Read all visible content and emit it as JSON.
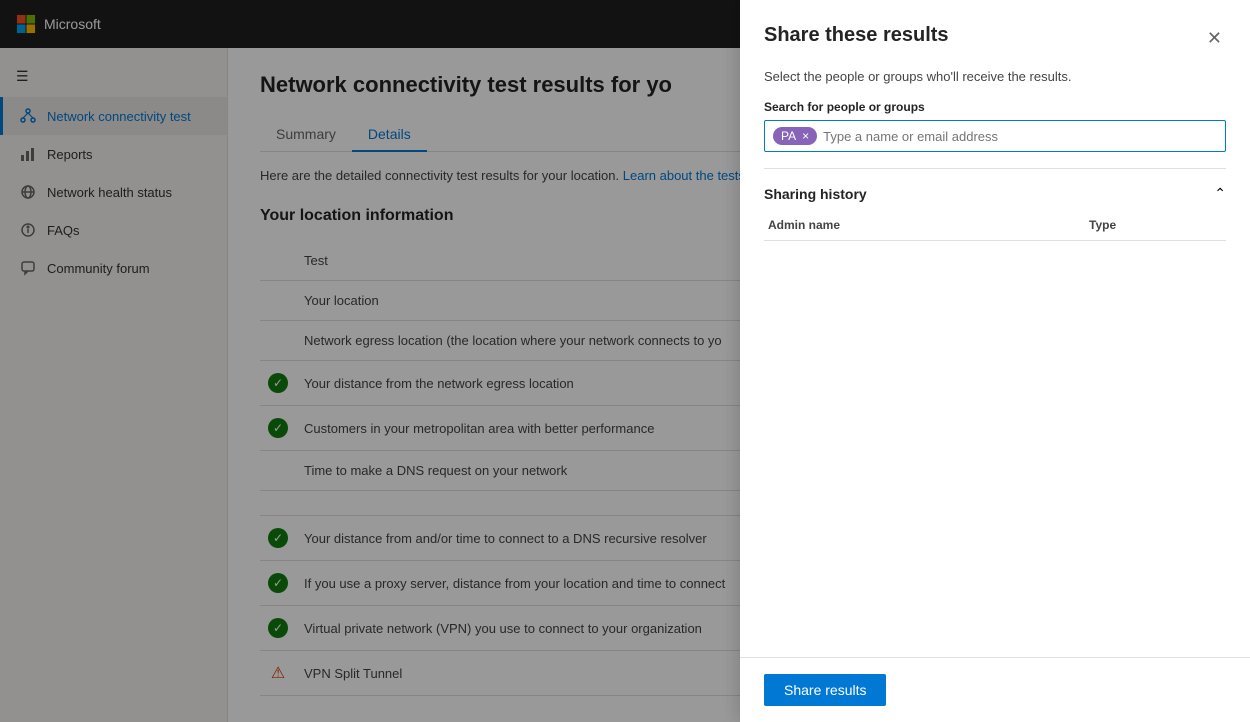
{
  "topbar": {
    "logo_text": "Microsoft"
  },
  "sidebar": {
    "hamburger_label": "☰",
    "items": [
      {
        "id": "network-connectivity",
        "label": "Network connectivity test",
        "icon": "network",
        "active": true
      },
      {
        "id": "reports",
        "label": "Reports",
        "icon": "bar-chart"
      },
      {
        "id": "network-health",
        "label": "Network health status",
        "icon": "globe"
      },
      {
        "id": "faqs",
        "label": "FAQs",
        "icon": "info"
      },
      {
        "id": "community-forum",
        "label": "Community forum",
        "icon": "chat"
      }
    ]
  },
  "main": {
    "page_title": "Network connectivity test results for yo",
    "tabs": [
      {
        "id": "summary",
        "label": "Summary",
        "active": false
      },
      {
        "id": "details",
        "label": "Details",
        "active": true
      }
    ],
    "description": "Here are the detailed connectivity test results for your location.",
    "learn_link": "Learn about the tests",
    "section_title": "Your location information",
    "rows": [
      {
        "status": "",
        "text": "Test"
      },
      {
        "status": "",
        "text": "Your location"
      },
      {
        "status": "",
        "text": ""
      },
      {
        "status": "",
        "text": "Network egress location (the location where your network connects to yo"
      },
      {
        "status": "ok",
        "text": "Your distance from the network egress location"
      },
      {
        "status": "ok",
        "text": "Customers in your metropolitan area with better performance"
      },
      {
        "status": "",
        "text": ""
      },
      {
        "status": "",
        "text": "Time to make a DNS request on your network"
      },
      {
        "status": "",
        "text": ""
      },
      {
        "status": "ok",
        "text": "Your distance from and/or time to connect to a DNS recursive resolver"
      },
      {
        "status": "ok",
        "text": "If you use a proxy server, distance from your location and time to connect"
      },
      {
        "status": "ok",
        "text": "Virtual private network (VPN) you use to connect to your organization"
      },
      {
        "status": "warn",
        "text": "VPN Split Tunnel"
      }
    ]
  },
  "panel": {
    "title": "Share these results",
    "close_label": "✕",
    "subtitle": "Select the people or groups who'll receive the results.",
    "search_label": "Search for people or groups",
    "tag": {
      "initials": "PA",
      "remove": "×"
    },
    "search_placeholder": "Type a name or email address",
    "sharing_history_title": "Sharing history",
    "collapse_icon": "⌃",
    "history_columns": [
      "Admin name",
      "Type"
    ],
    "history_rows": [],
    "share_button_label": "Share results"
  }
}
